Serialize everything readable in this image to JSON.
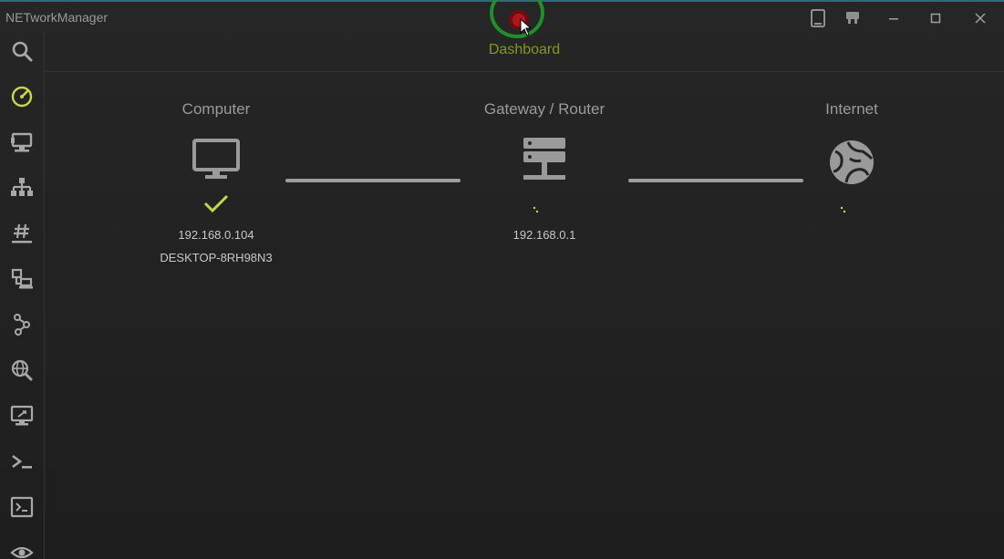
{
  "app": {
    "title": "NETworkManager"
  },
  "header": {
    "title": "Dashboard"
  },
  "sidebar": {
    "items": [
      {
        "icon": "search-icon"
      },
      {
        "icon": "dashboard-gauge-icon",
        "active": true
      },
      {
        "icon": "network-interface-icon"
      },
      {
        "icon": "ip-scanner-icon"
      },
      {
        "icon": "subnet-hash-icon"
      },
      {
        "icon": "port-scanner-icon"
      },
      {
        "icon": "traceroute-icon"
      },
      {
        "icon": "dns-lookup-icon"
      },
      {
        "icon": "remote-desktop-icon"
      },
      {
        "icon": "powershell-icon"
      },
      {
        "icon": "putty-terminal-icon"
      },
      {
        "icon": "eye-icon"
      }
    ]
  },
  "dashboard": {
    "computer": {
      "label": "Computer",
      "ip": "192.168.0.104",
      "hostname": "DESKTOP-8RH98N3",
      "status": "ok"
    },
    "gateway": {
      "label": "Gateway / Router",
      "ip": "192.168.0.1",
      "status": "loading"
    },
    "internet": {
      "label": "Internet",
      "status": "loading"
    }
  },
  "colors": {
    "accent": "#7f9a1a",
    "check": "#c8d64a",
    "icon": "#a8a8a8",
    "background": "#252525",
    "record": "#b1161e",
    "highlight_ring": "#1f8f2a"
  }
}
